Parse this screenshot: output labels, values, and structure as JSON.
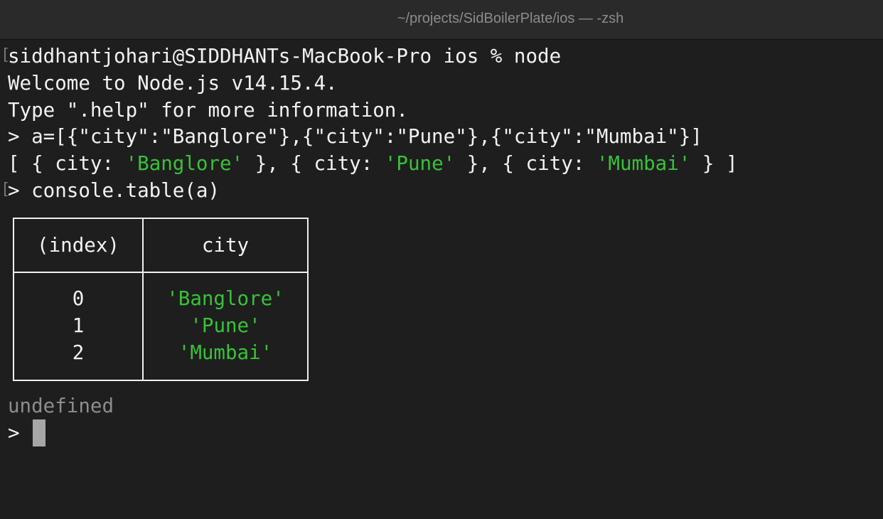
{
  "window": {
    "title": "~/projects/SidBoilerPlate/ios — -zsh"
  },
  "terminal": {
    "marks": {
      "bracket": "["
    },
    "line1_prompt": "siddhantjohari@SIDDHANTs-MacBook-Pro ios % node",
    "line2_welcome": "Welcome to Node.js v14.15.4.",
    "line3_help": "Type \".help\" for more information.",
    "line4_input": "> a=[{\"city\":\"Banglore\"},{\"city\":\"Pune\"},{\"city\":\"Mumbai\"}]",
    "line5_output": {
      "open": "[ { city: ",
      "v1": "'Banglore'",
      "sep1": " }, { city: ",
      "v2": "'Pune'",
      "sep2": " }, { city: ",
      "v3": "'Mumbai'",
      "close": " } ]"
    },
    "line6_input": "> console.table(a)",
    "table": {
      "headers": [
        "(index)",
        "city"
      ],
      "rows": [
        {
          "index": "0",
          "city": "'Banglore'"
        },
        {
          "index": "1",
          "city": "'Pune'"
        },
        {
          "index": "2",
          "city": "'Mumbai'"
        }
      ]
    },
    "undefined_text": "undefined",
    "final_prompt": ">"
  },
  "colors": {
    "background": "#1e1e1e",
    "text": "#f2f2f2",
    "string": "#38c238",
    "dim": "#8d8d8d",
    "cursor": "#a6a6a6"
  }
}
